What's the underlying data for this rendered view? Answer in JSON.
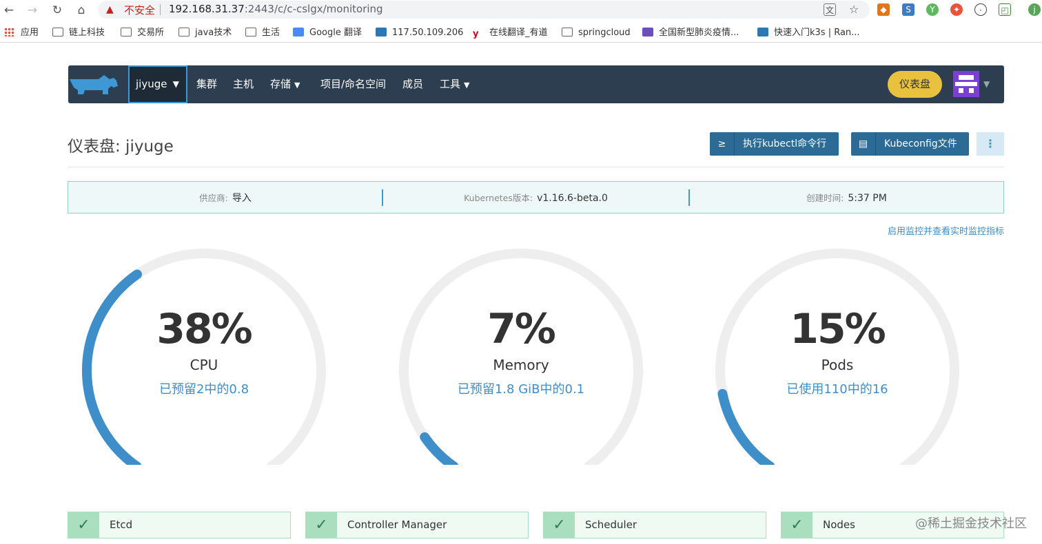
{
  "browser": {
    "warning": "不安全",
    "url_host": "192.168.31.37",
    "url_rest": ":2443/c/c-cslgx/monitoring",
    "bookmarks": [
      "应用",
      "链上科技",
      "交易所",
      "java技术",
      "生活",
      "Google 翻译",
      "117.50.109.206",
      "在线翻译_有道",
      "springcloud",
      "全国新型肺炎疫情...",
      "快速入门k3s | Ran..."
    ]
  },
  "header": {
    "cluster": "jiyuge",
    "nav": [
      "集群",
      "主机",
      "存储",
      "项目/命名空间",
      "成员",
      "工具"
    ],
    "dashboard_button": "仪表盘"
  },
  "page": {
    "title": "仪表盘: jiyuge",
    "kubectl_button": "执行kubectl命令行",
    "kubeconfig_button": "Kubeconfig文件",
    "more_button": "⋮"
  },
  "info": {
    "provider_label": "供应商:",
    "provider_value": "导入",
    "k8s_label": "Kubernetes版本:",
    "k8s_value": "v1.16.6-beta.0",
    "created_label": "创建时间:",
    "created_value": "5:37 PM"
  },
  "monitoring_link": "启用监控并查看实时监控指标",
  "gauges": [
    {
      "percent": "38%",
      "name": "CPU",
      "detail": "已预留2中的0.8",
      "value": 0.38
    },
    {
      "percent": "7%",
      "name": "Memory",
      "detail": "已预留1.8 GiB中的0.1",
      "value": 0.07
    },
    {
      "percent": "15%",
      "name": "Pods",
      "detail": "已使用110中的16",
      "value": 0.15
    }
  ],
  "components": [
    "Etcd",
    "Controller Manager",
    "Scheduler",
    "Nodes"
  ],
  "watermark": "@稀土掘金技术社区",
  "colors": {
    "header_bg": "#2d3e50",
    "accent": "#3d8ec9",
    "gauge_fill": "#3d8ec9",
    "gauge_track": "#eeeeee",
    "ok": "#a9dfbf"
  }
}
